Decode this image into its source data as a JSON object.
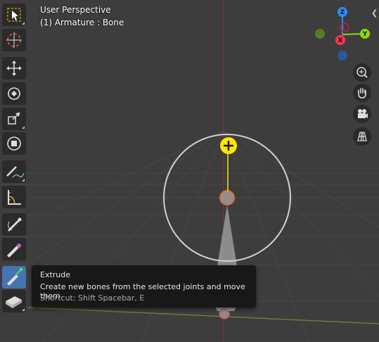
{
  "viewport": {
    "view_name": "User Perspective",
    "object_info": "(1) Armature : Bone"
  },
  "toolbar": {
    "tools": [
      {
        "name": "select-box",
        "icon": "select-box-icon"
      },
      {
        "name": "cursor",
        "icon": "cursor-icon"
      },
      {
        "name": "move",
        "icon": "move-icon"
      },
      {
        "name": "rotate",
        "icon": "rotate-icon"
      },
      {
        "name": "scale",
        "icon": "scale-icon"
      },
      {
        "name": "transform",
        "icon": "transform-icon"
      },
      {
        "name": "annotate",
        "icon": "annotate-icon"
      },
      {
        "name": "measure",
        "icon": "measure-icon"
      },
      {
        "name": "roll",
        "icon": "bone-roll-icon"
      },
      {
        "name": "bone-size",
        "icon": "bone-size-icon"
      },
      {
        "name": "extrude",
        "icon": "extrude-icon",
        "active": true
      },
      {
        "name": "bone-envelope",
        "icon": "bone-envelope-icon"
      }
    ]
  },
  "navigation": {
    "gizmo_axes": {
      "x": "X",
      "y": "Y",
      "z": "Z"
    },
    "buttons": [
      "zoom-icon",
      "hand-pan-icon",
      "camera-icon",
      "grid-icon"
    ]
  },
  "tooltip": {
    "title": "Extrude",
    "description": "Create new bones from the selected joints and move them.",
    "shortcut": "Shortcut: Shift Spacebar, E"
  },
  "colors": {
    "background": "#3d3d3d",
    "grid": "#474747",
    "x_axis": "#ff3352",
    "y_axis": "#8bdc00",
    "z_axis": "#2890ff",
    "active_tool": "#4772b3",
    "cursor_yellow": "#ffe600"
  }
}
